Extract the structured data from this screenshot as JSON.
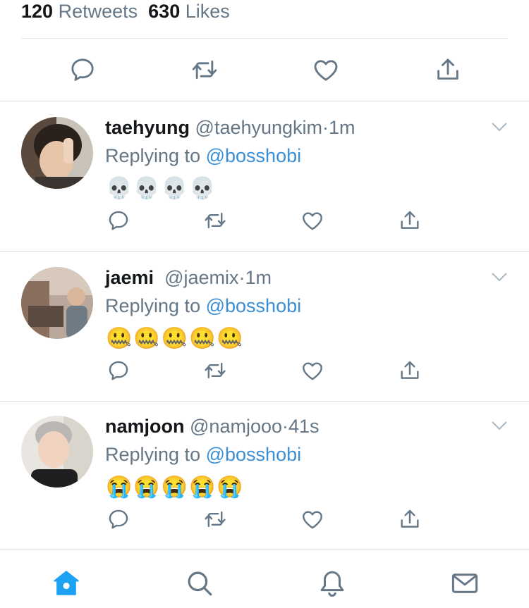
{
  "stats": {
    "retweets_count": "120",
    "retweets_label": "Retweets",
    "likes_count": "630",
    "likes_label": "Likes"
  },
  "main_actions": [
    "reply-icon",
    "retweet-icon",
    "like-icon",
    "share-icon"
  ],
  "replies": [
    {
      "name": "taehyung",
      "handle": "@taehyungkim",
      "separator": "·",
      "time": "1m",
      "replying_label": "Replying to",
      "replying_to": "@bosshobi",
      "text": "💀💀💀💀"
    },
    {
      "name": "jaemi",
      "handle": "@jaemix",
      "separator": "·",
      "time": "1m",
      "replying_label": "Replying to",
      "replying_to": "@bosshobi",
      "text": "🤐🤐🤐🤐🤐"
    },
    {
      "name": "namjoon",
      "handle": "@namjooo",
      "separator": "·",
      "time": "41s",
      "replying_label": "Replying to",
      "replying_to": "@bosshobi",
      "text": "😭😭😭😭😭"
    }
  ],
  "tabbar": {
    "active": "home",
    "tabs": [
      "home-icon",
      "search-icon",
      "notifications-icon",
      "messages-icon"
    ]
  },
  "colors": {
    "accent": "#1da1f2",
    "secondary_text": "#657786",
    "icon_gray": "#657786",
    "divider": "#e1e8ed"
  }
}
